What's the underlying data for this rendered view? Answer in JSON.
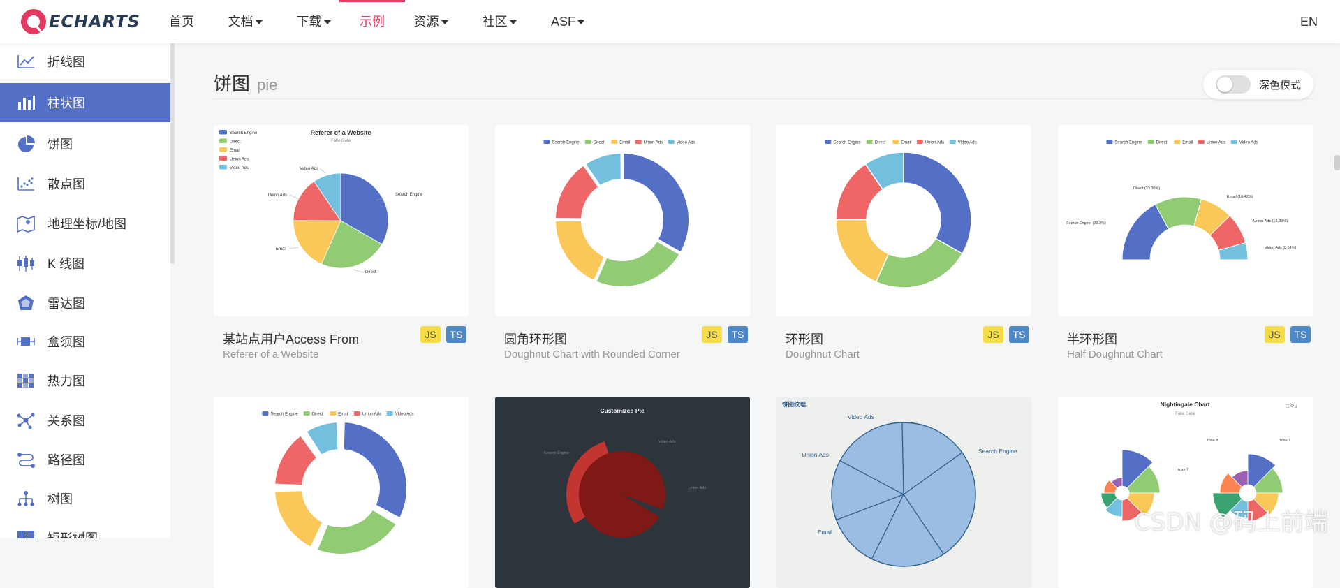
{
  "brand": {
    "name": "ECHARTS"
  },
  "nav": {
    "items": [
      {
        "label": "首页",
        "dropdown": false,
        "active": false
      },
      {
        "label": "文档",
        "dropdown": true,
        "active": false
      },
      {
        "label": "下载",
        "dropdown": true,
        "active": false
      },
      {
        "label": "示例",
        "dropdown": false,
        "active": true
      },
      {
        "label": "资源",
        "dropdown": true,
        "active": false
      },
      {
        "label": "社区",
        "dropdown": true,
        "active": false
      },
      {
        "label": "ASF",
        "dropdown": true,
        "active": false
      }
    ],
    "lang": "EN"
  },
  "sidebar": {
    "items": [
      {
        "label": "折线图",
        "icon": "line-chart-icon",
        "active": false
      },
      {
        "label": "柱状图",
        "icon": "bar-chart-icon",
        "active": true
      },
      {
        "label": "饼图",
        "icon": "pie-chart-icon",
        "active": false
      },
      {
        "label": "散点图",
        "icon": "scatter-chart-icon",
        "active": false
      },
      {
        "label": "地理坐标/地图",
        "icon": "map-icon",
        "active": false
      },
      {
        "label": "K 线图",
        "icon": "candlestick-icon",
        "active": false
      },
      {
        "label": "雷达图",
        "icon": "radar-icon",
        "active": false
      },
      {
        "label": "盒须图",
        "icon": "boxplot-icon",
        "active": false
      },
      {
        "label": "热力图",
        "icon": "heatmap-icon",
        "active": false
      },
      {
        "label": "关系图",
        "icon": "graph-icon",
        "active": false
      },
      {
        "label": "路径图",
        "icon": "lines-icon",
        "active": false
      },
      {
        "label": "树图",
        "icon": "tree-icon",
        "active": false
      },
      {
        "label": "矩形树图",
        "icon": "treemap-icon",
        "active": false
      }
    ]
  },
  "section": {
    "title": "饼图",
    "subtitle": "pie"
  },
  "dark_mode": {
    "label": "深色模式",
    "on": false
  },
  "badges": {
    "js": "JS",
    "ts": "TS"
  },
  "palette": [
    "#5470c6",
    "#91cc75",
    "#fac858",
    "#ee6666",
    "#73c0de",
    "#3ba272",
    "#fc8452",
    "#9a60b4"
  ],
  "legend_labels": [
    "Search Engine",
    "Direct",
    "Email",
    "Union Ads",
    "Video Ads"
  ],
  "cards": [
    {
      "title": "某站点用户Access From",
      "subtitle": "Referer of a Website"
    },
    {
      "title": "圆角环形图",
      "subtitle": "Doughnut Chart with Rounded Corner"
    },
    {
      "title": "环形图",
      "subtitle": "Doughnut Chart"
    },
    {
      "title": "半环形图",
      "subtitle": "Half Doughnut Chart"
    }
  ],
  "thumbs": {
    "referer": {
      "title": "Referer of a Website",
      "subtitle": "Fake Data"
    },
    "half": {
      "labels": [
        "Search Engine (33.3%)",
        "Direct (23.36%)",
        "Email (16.42%)",
        "Union Ads (15.39%)",
        "Video Ads (8.54%)"
      ]
    },
    "customized": {
      "title": "Customized Pie"
    },
    "texture": {
      "title": "饼图纹理"
    },
    "nightingale": {
      "title": "Nightingale Chart",
      "subtitle": "Fake Data",
      "labels": [
        "rose 1",
        "rose 7",
        "rose 8"
      ]
    }
  },
  "chart_data": [
    {
      "type": "pie",
      "title": "Referer of a Website",
      "subtitle": "Fake Data",
      "categories": [
        "Search Engine",
        "Direct",
        "Email",
        "Union Ads",
        "Video Ads"
      ],
      "values": [
        1048,
        735,
        580,
        484,
        300
      ]
    },
    {
      "type": "pie",
      "categories": [
        "Search Engine",
        "Direct",
        "Email",
        "Union Ads",
        "Video Ads"
      ],
      "values": [
        1048,
        735,
        580,
        484,
        300
      ]
    },
    {
      "type": "pie",
      "categories": [
        "Search Engine",
        "Direct",
        "Email",
        "Union Ads",
        "Video Ads"
      ],
      "values": [
        1048,
        735,
        580,
        484,
        300
      ]
    },
    {
      "type": "pie",
      "categories": [
        "Search Engine",
        "Direct",
        "Email",
        "Union Ads",
        "Video Ads"
      ],
      "values": [
        33.3,
        23.36,
        16.42,
        15.39,
        8.54
      ]
    }
  ],
  "watermark": "CSDN @码上前端"
}
